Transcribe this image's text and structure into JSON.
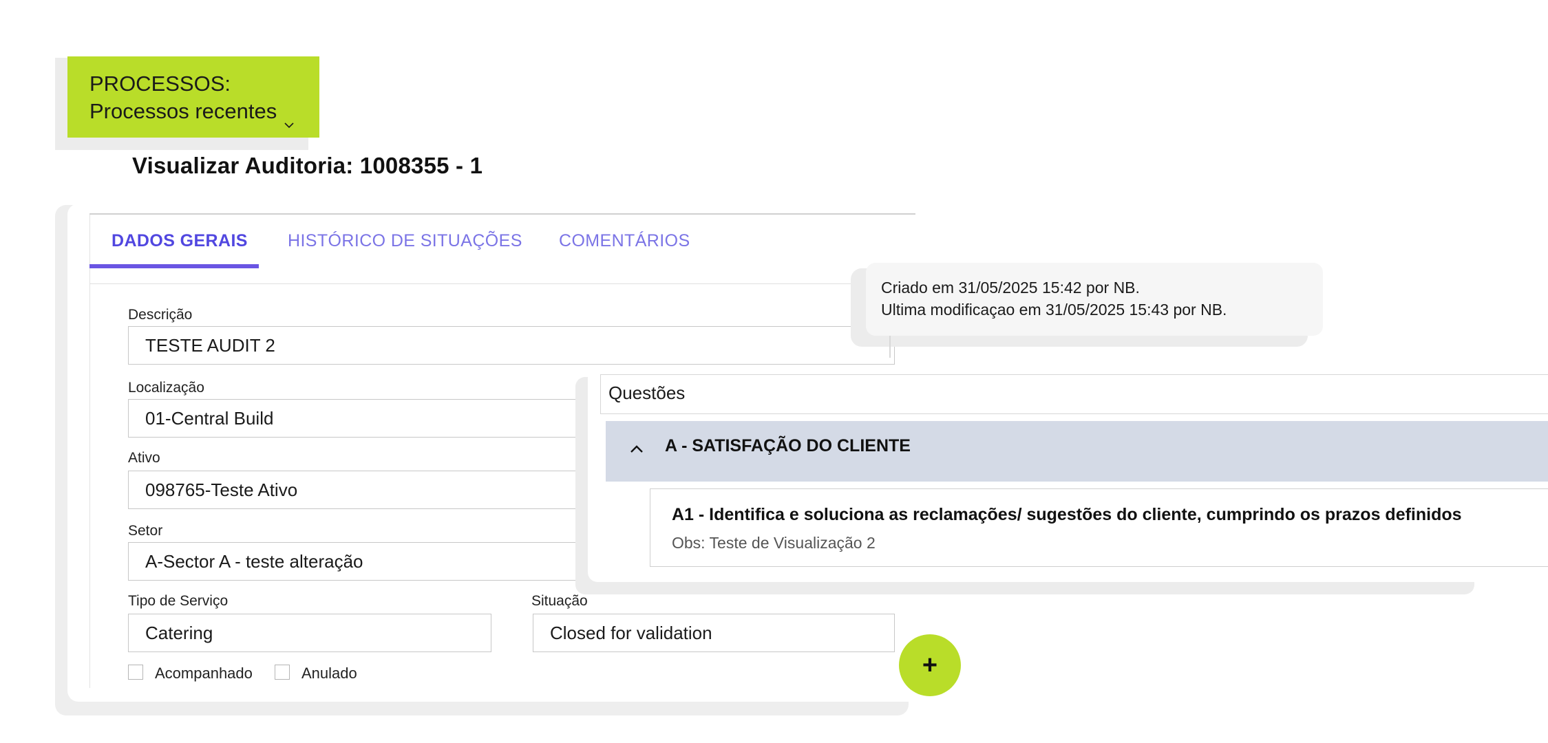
{
  "process_badge": {
    "line1": "PROCESSOS:",
    "line2": "Processos recentes",
    "color": "#b9dd29"
  },
  "page_title": "Visualizar Auditoria: 1008355 - 1",
  "tabs": [
    {
      "label": "DADOS GERAIS",
      "active": true
    },
    {
      "label": "HISTÓRICO DE SITUAÇÕES",
      "active": false
    },
    {
      "label": "COMENTÁRIOS",
      "active": false
    }
  ],
  "form": {
    "descricao": {
      "label": "Descrição",
      "value": "TESTE AUDIT 2"
    },
    "localizacao": {
      "label": "Localização",
      "value": "01-Central Build"
    },
    "ativo": {
      "label": "Ativo",
      "value": "098765-Teste Ativo"
    },
    "setor": {
      "label": "Setor",
      "value": "A-Sector A - teste alteração"
    },
    "tipo_servico": {
      "label": "Tipo de Serviço",
      "value": "Catering"
    },
    "situacao": {
      "label": "Situação",
      "value": "Closed for validation"
    },
    "checkboxes": [
      {
        "label": "Acompanhado",
        "checked": false
      },
      {
        "label": "Anulado",
        "checked": false
      }
    ]
  },
  "audit_info": {
    "created": "Criado em 31/05/2025 15:42 por NB.",
    "modified": "Ultima modificaçao em 31/05/2025 15:43 por NB."
  },
  "questions": {
    "title": "Questões",
    "section_title": "A - SATISFAÇÃO DO CLIENTE",
    "item_title": "A1 - Identifica e soluciona as reclamações/ sugestões do cliente, cumprindo os prazos definidos",
    "item_obs": "Obs: Teste de Visualização 2"
  },
  "fab_label": "+",
  "colors": {
    "accent_green": "#b9dd29",
    "tab_active": "#5147e0",
    "tab_inactive": "#7b74e6",
    "section_bg": "#d4dae6"
  }
}
